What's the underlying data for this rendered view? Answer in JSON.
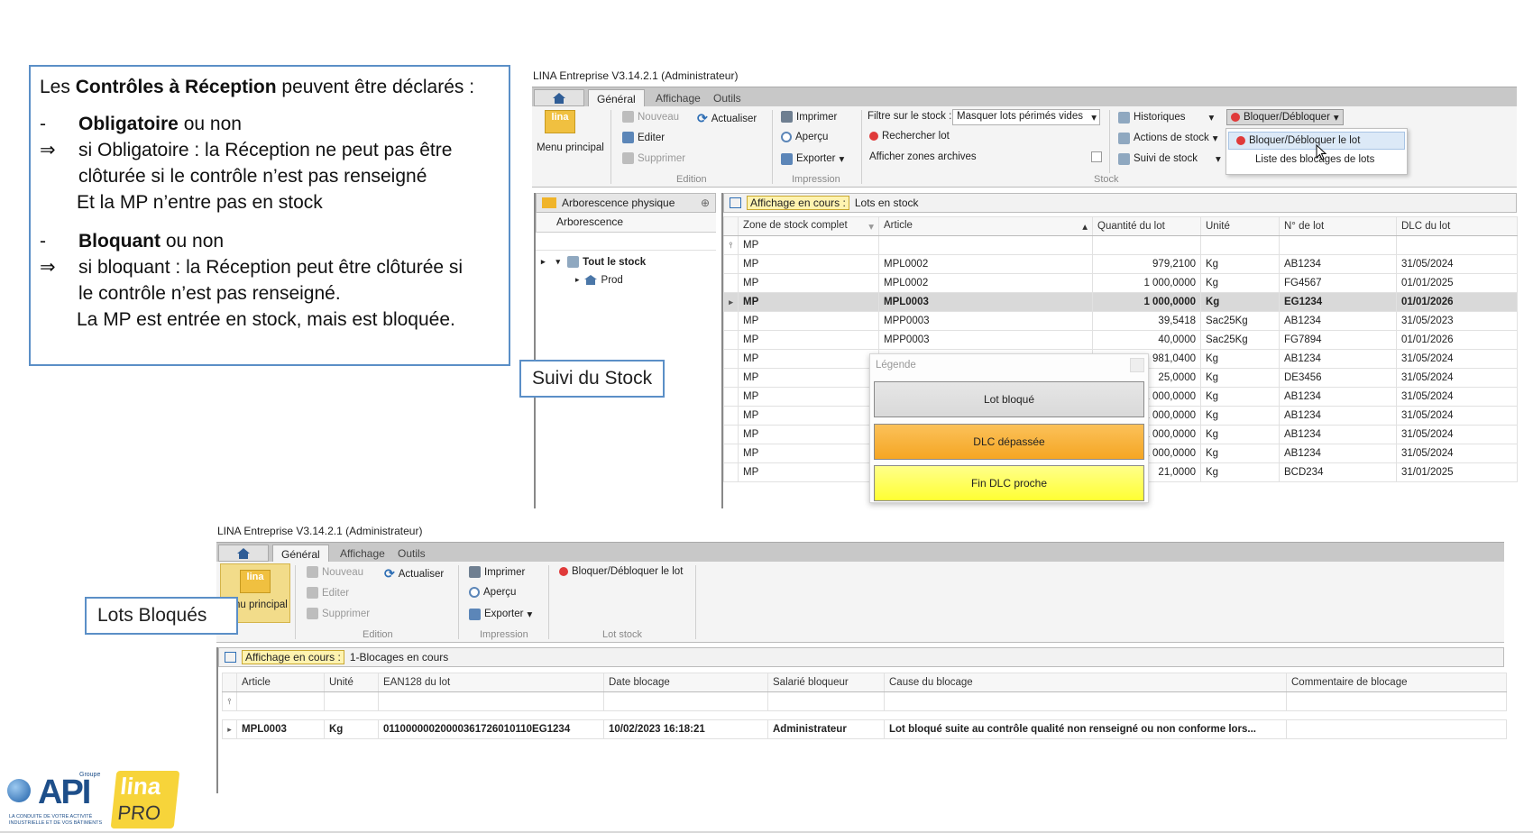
{
  "slide": {
    "intro_pre": "Les ",
    "intro_bold": "Contrôles à Réception",
    "intro_post": " peuvent être déclarés :",
    "dash": "-",
    "arrow": "⇒",
    "b1_bold": "Obligatoire",
    "b1_post": " ou non",
    "b1_l1": "si Obligatoire : la Réception ne peut pas être",
    "b1_l2": "clôturée si le contrôle n’est pas renseigné",
    "b1_l3": "Et la MP n’entre pas en stock",
    "b2_bold": "Bloquant",
    "b2_post": " ou non",
    "b2_l1": "si bloquant : la Réception peut être clôturée si",
    "b2_l2": "le contrôle n’est pas renseigné.",
    "b2_l3": "La MP est entrée en stock, mais est bloquée.",
    "callout_stock": "Suivi du Stock",
    "callout_lots": "Lots Bloqués"
  },
  "win1": {
    "title": "LINA Entreprise  V3.14.2.1  (Administrateur)",
    "tabs": [
      "Général",
      "Affichage",
      "Outils"
    ],
    "menu_principal": "Menu principal",
    "logo_text": "lina",
    "edition": {
      "nouveau": "Nouveau",
      "actualiser": "Actualiser",
      "editer": "Editer",
      "supprimer": "Supprimer",
      "label": "Edition"
    },
    "impression": {
      "imprimer": "Imprimer",
      "apercu": "Aperçu",
      "exporter": "Exporter",
      "label": "Impression"
    },
    "stock": {
      "filtre_label": "Filtre sur le stock :",
      "filtre_value": "Masquer lots périmés vides",
      "rechercher": "Rechercher lot",
      "afficher_archives": "Afficher zones archives",
      "historiques": "Historiques",
      "actions": "Actions de stock",
      "suivi": "Suivi de stock",
      "bloquer_btn": "Bloquer/Débloquer",
      "label": "Stock"
    },
    "dropdown": [
      "Bloquer/Débloquer le lot",
      "Liste des blocages de lots"
    ],
    "tree": {
      "header": "Arborescence physique",
      "col": "Arborescence",
      "root": "Tout le stock",
      "child": "Prod"
    },
    "affichage_label": "Affichage en cours :",
    "affichage_value": "Lots en stock",
    "columns": [
      "Zone de stock complet",
      "Article",
      "Quantité du lot",
      "Unité",
      "N° de lot",
      "DLC du lot"
    ],
    "filter_value": "MP",
    "rows": [
      [
        "MP",
        "MPL0002",
        "979,2100",
        "Kg",
        "AB1234",
        "31/05/2024"
      ],
      [
        "MP",
        "MPL0002",
        "1 000,0000",
        "Kg",
        "FG4567",
        "01/01/2025"
      ],
      [
        "MP",
        "MPL0003",
        "1 000,0000",
        "Kg",
        "EG1234",
        "01/01/2026"
      ],
      [
        "MP",
        "MPP0003",
        "39,5418",
        "Sac25Kg",
        "AB1234",
        "31/05/2023"
      ],
      [
        "MP",
        "MPP0003",
        "40,0000",
        "Sac25Kg",
        "FG7894",
        "01/01/2026"
      ],
      [
        "MP",
        "",
        "981,0400",
        "Kg",
        "AB1234",
        "31/05/2024"
      ],
      [
        "MP",
        "",
        "25,0000",
        "Kg",
        "DE3456",
        "31/05/2024"
      ],
      [
        "MP",
        "",
        "1 000,0000",
        "Kg",
        "AB1234",
        "31/05/2024"
      ],
      [
        "MP",
        "",
        "1 000,0000",
        "Kg",
        "AB1234",
        "31/05/2024"
      ],
      [
        "MP",
        "",
        "1 000,0000",
        "Kg",
        "AB1234",
        "31/05/2024"
      ],
      [
        "MP",
        "",
        "1 000,0000",
        "Kg",
        "AB1234",
        "31/05/2024"
      ],
      [
        "MP",
        "",
        "21,0000",
        "Kg",
        "BCD234",
        "31/01/2025"
      ]
    ],
    "legend": {
      "title": "Légende",
      "items": [
        "Lot bloqué",
        "DLC dépassée",
        "Fin DLC proche"
      ],
      "colors": [
        "#d9d9d9",
        "#f5a623",
        "#ffff33"
      ]
    }
  },
  "win2": {
    "title": "LINA Entreprise  V3.14.2.1  (Administrateur)",
    "tabs": [
      "Général",
      "Affichage",
      "Outils"
    ],
    "menu_principal": "Menu principal",
    "edition": {
      "nouveau": "Nouveau",
      "actualiser": "Actualiser",
      "editer": "Editer",
      "supprimer": "Supprimer",
      "label": "Edition"
    },
    "impression": {
      "imprimer": "Imprimer",
      "apercu": "Aperçu",
      "exporter": "Exporter",
      "label": "Impression"
    },
    "lot_stock": {
      "bloquer": "Bloquer/Débloquer le lot",
      "label": "Lot stock"
    },
    "affichage_label": "Affichage en cours :",
    "affichage_value": "1-Blocages en cours",
    "columns": [
      "Article",
      "Unité",
      "EAN128 du lot",
      "Date blocage",
      "Salarié bloqueur",
      "Cause du blocage",
      "Commentaire de blocage"
    ],
    "row": [
      "MPL0003",
      "Kg",
      "01100000020000361726010110EG1234",
      "10/02/2023 16:18:21",
      "Administrateur",
      "Lot bloqué suite au contrôle qualité non renseigné ou non conforme lors...",
      ""
    ]
  },
  "logos": {
    "groupe": "Groupe",
    "api": "API",
    "tagline": "LA CONDUITE DE VOTRE ACTIVITÉ INDUSTRIELLE ET DE VOS BÂTIMENTS",
    "lina": "lina",
    "pro": "PRO"
  }
}
